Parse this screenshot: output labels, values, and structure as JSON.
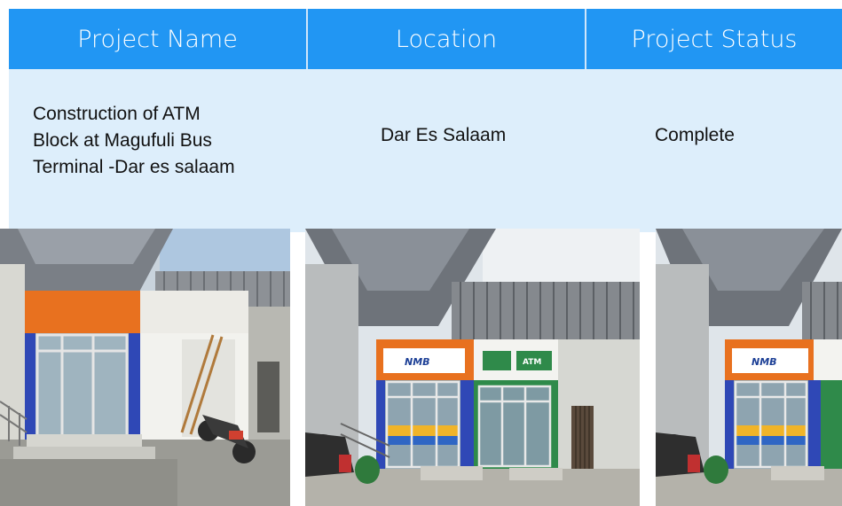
{
  "table": {
    "headers": [
      "Project Name",
      "Location",
      "Project Status"
    ],
    "rows": [
      {
        "name_lines": [
          "Construction of ATM",
          "Block at Magufuli Bus",
          "Terminal -Dar es salaam"
        ],
        "location": "Dar Es Salaam",
        "status": "Complete"
      }
    ]
  },
  "photos": [
    {
      "subject": "atm-block-under-construction"
    },
    {
      "subject": "completed-atm-block",
      "signs": [
        "NMB",
        "ATM",
        "ATM"
      ]
    },
    {
      "subject": "completed-atm-block-cropped",
      "signs": [
        "NMB"
      ]
    }
  ],
  "colors": {
    "header_bg": "#2196f3",
    "row_bg": "#ddeefb",
    "header_text": "#ffffff",
    "orange": "#e8711f",
    "blue_panel": "#2f48b6",
    "green_panel": "#2f8a4a"
  }
}
